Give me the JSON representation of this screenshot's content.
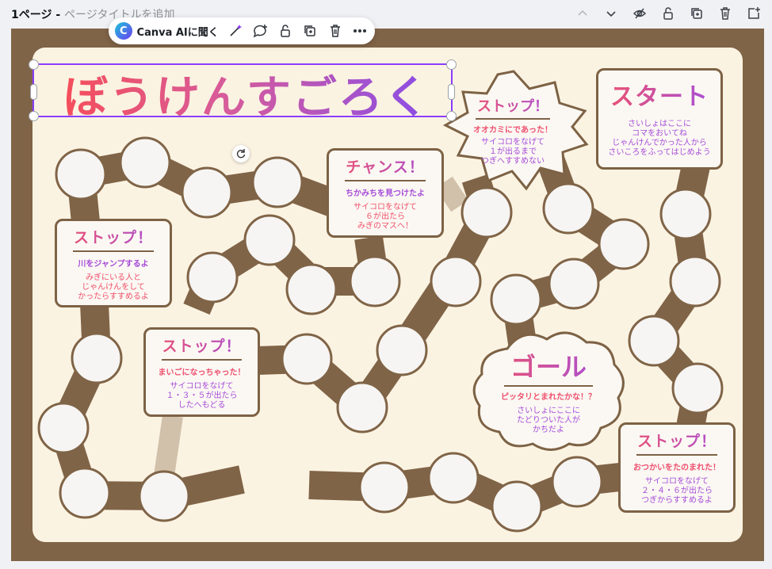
{
  "topbar": {
    "page_number": "1ページ - ",
    "page_title_placeholder": "ページタイトルを追加",
    "icons": [
      "chevron-up-icon",
      "chevron-down-icon",
      "hide-icon",
      "lock-icon",
      "duplicate-icon",
      "trash-icon",
      "add-page-icon"
    ]
  },
  "toolbar": {
    "ai_button_label": "Canva AIに聞く",
    "logo_letter": "C",
    "icons": [
      "magic-edit-icon",
      "comment-add-icon",
      "lock-icon",
      "duplicate-icon",
      "trash-icon",
      "more-icon"
    ]
  },
  "board": {
    "title": "ぼうけんすごろく",
    "colors": {
      "frame": "#806447",
      "background": "#fbf3e2",
      "space_fill": "#f6f5f3",
      "accent_pink": "#f0506a",
      "accent_purple": "#a34fde"
    },
    "cards": {
      "start": {
        "heading": "スタート",
        "body": [
          "さいしょはここに",
          "コマをおいてね",
          "じゃんけんでかった人から",
          "さいころをふってはじめよう"
        ]
      },
      "stop_wolf": {
        "heading": "ストップ！",
        "sub": "オオカミにであった！",
        "body": [
          "サイコロをなげて",
          "１が出るまで",
          "つぎへすすめない"
        ]
      },
      "chance": {
        "heading": "チャンス！",
        "sub": "ちかみちを見つけたよ",
        "body": [
          "サイコロをなげて",
          "６が出たら",
          "みぎのマスへ！"
        ]
      },
      "stop_river": {
        "heading": "ストップ！",
        "sub": "川をジャンプするよ",
        "body": [
          "みぎにいる人と",
          "じゃんけんをして",
          "かったらすすめるよ"
        ]
      },
      "stop_lost": {
        "heading": "ストップ！",
        "sub": "まいごになっちゃった！",
        "body": [
          "サイコロをなげて",
          "１・３・５が出たら",
          "したへもどる"
        ]
      },
      "goal": {
        "heading": "ゴール",
        "sub": "ピッタリとまれたかな！？",
        "body": [
          "さいしょにここに",
          "たどりついた人が",
          "かちだよ"
        ]
      },
      "stop_errand": {
        "heading": "ストップ！",
        "sub": "おつかいをたのまれた！",
        "body": [
          "サイコロをなげて",
          "２・４・６が出たら",
          "つぎからすすめるよ"
        ]
      }
    }
  }
}
